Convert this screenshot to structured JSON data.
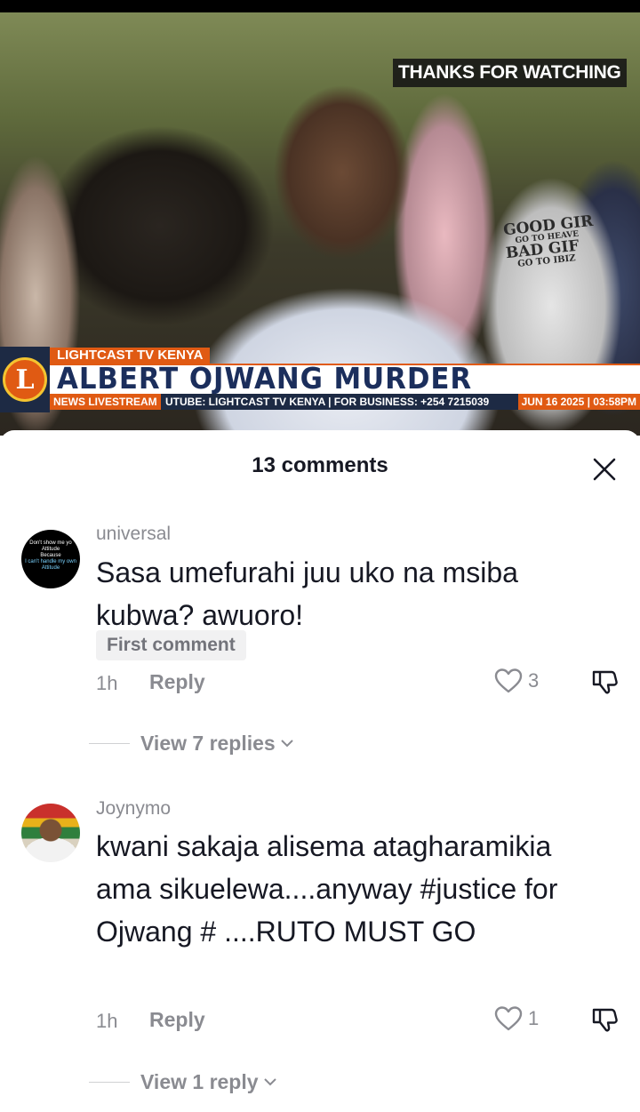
{
  "video": {
    "overlay_text": "THANKS FOR WATCHING",
    "shirt_lines": [
      "GOOD GIR",
      "GO TO HEAVE",
      "BAD GIF",
      "GO TO IBIZ"
    ],
    "channel_name": "LIGHTCAST TV KENYA",
    "headline": "ALBERT OJWANG MURDER",
    "ticker_tag": "NEWS LIVESTREAM",
    "ticker_text": "UTUBE: LIGHTCAST TV KENYA | FOR BUSINESS: +254 7215039",
    "ticker_date": "JUN 16 2025 | 03:58PM",
    "logo_letter": "L"
  },
  "sheet": {
    "title": "13 comments"
  },
  "comments": [
    {
      "username": "universal",
      "avatar_lines": [
        "Don't show me yo",
        "Attitude",
        "Because",
        "I can't handle my own",
        "Attitude"
      ],
      "text": "Sasa umefurahi juu uko na msiba kubwa? awuoro!",
      "badge": "First comment",
      "time": "1h",
      "reply_label": "Reply",
      "likes": "3",
      "view_replies": "View 7 replies"
    },
    {
      "username": "Joynymo",
      "text": "kwani sakaja alisema atagharamikia ama sikuelewa....anyway #justice for Ojwang # ....RUTO MUST GO",
      "time": "1h",
      "reply_label": "Reply",
      "likes": "1",
      "view_replies": "View 1 reply"
    }
  ],
  "colors": {
    "accent_orange": "#e05a13",
    "headline_navy": "#1b2e5c",
    "muted_text": "#8a8b91"
  }
}
